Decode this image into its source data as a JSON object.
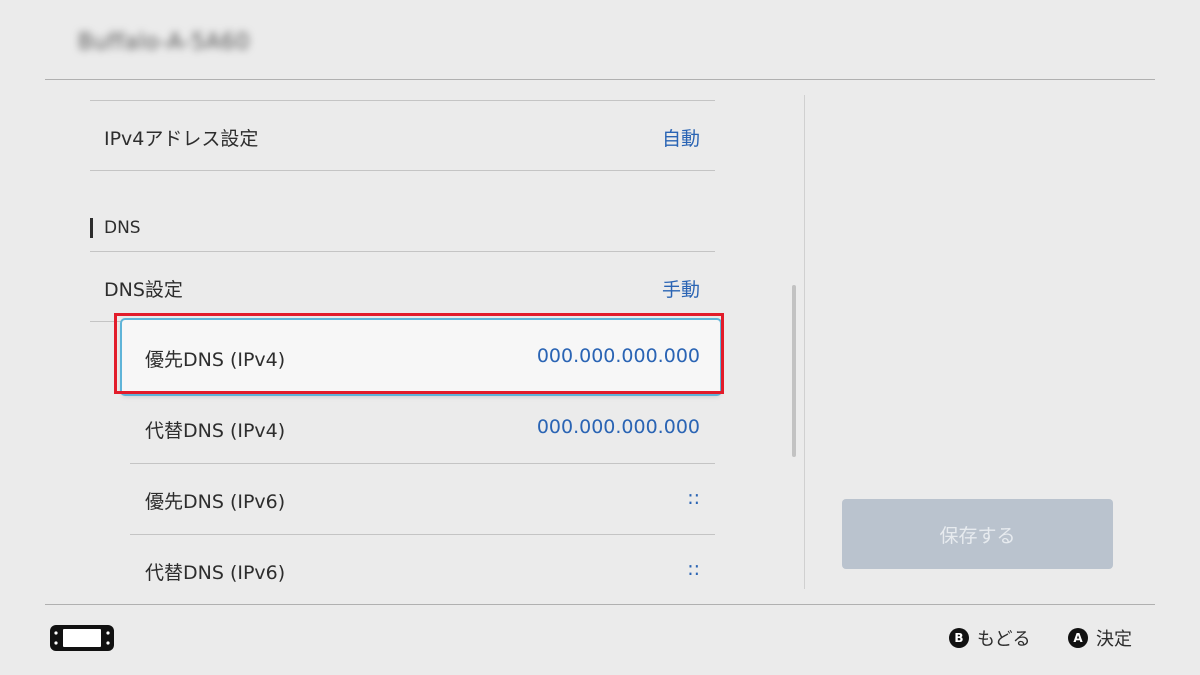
{
  "header": {
    "network_name": "Buffalo-A-5A60"
  },
  "settings": {
    "ipv4_address": {
      "label": "IPv4アドレス設定",
      "value": "自動"
    },
    "dns_section_label": "DNS",
    "dns_mode": {
      "label": "DNS設定",
      "value": "手動"
    },
    "dns_rows": [
      {
        "label": "優先DNS (IPv4)",
        "value": "000.000.000.000"
      },
      {
        "label": "代替DNS (IPv4)",
        "value": "000.000.000.000"
      },
      {
        "label": "優先DNS (IPv6)",
        "value": "::"
      },
      {
        "label": "代替DNS (IPv6)",
        "value": "::"
      }
    ]
  },
  "save_button_label": "保存する",
  "footer": {
    "back": {
      "glyph": "B",
      "label": "もどる"
    },
    "confirm": {
      "glyph": "A",
      "label": "決定"
    }
  },
  "colors": {
    "value_text": "#2a64b4",
    "highlight_border": "#e21c2a",
    "disabled_button": "#bac3ce"
  },
  "icons": {
    "console": "console-icon"
  }
}
